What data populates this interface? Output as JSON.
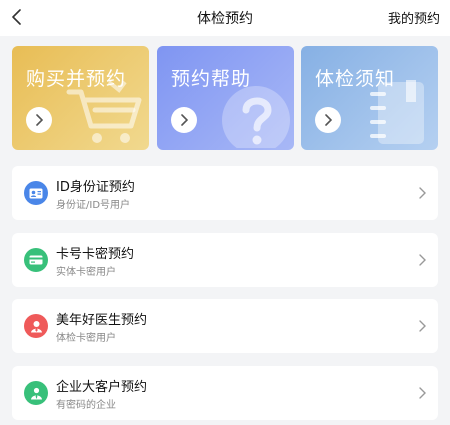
{
  "header": {
    "title": "体检预约",
    "my_appointments": "我的预约"
  },
  "cards": [
    {
      "label": "购买并预约",
      "icon": "cart-icon"
    },
    {
      "label": "预约帮助",
      "icon": "question-icon"
    },
    {
      "label": "体检须知",
      "icon": "notebook-icon"
    }
  ],
  "items": [
    {
      "title": "ID身份证预约",
      "subtitle": "身份证/ID号用户",
      "icon": "id-card-icon",
      "color": "#4a86e8"
    },
    {
      "title": "卡号卡密预约",
      "subtitle": "实体卡密用户",
      "icon": "card-icon",
      "color": "#38c07a"
    },
    {
      "title": "美年好医生预约",
      "subtitle": "体检卡密用户",
      "icon": "doctor-icon",
      "color": "#ef5a5a"
    },
    {
      "title": "企业大客户预约",
      "subtitle": "有密码的企业",
      "icon": "enterprise-icon",
      "color": "#38c07a"
    }
  ]
}
